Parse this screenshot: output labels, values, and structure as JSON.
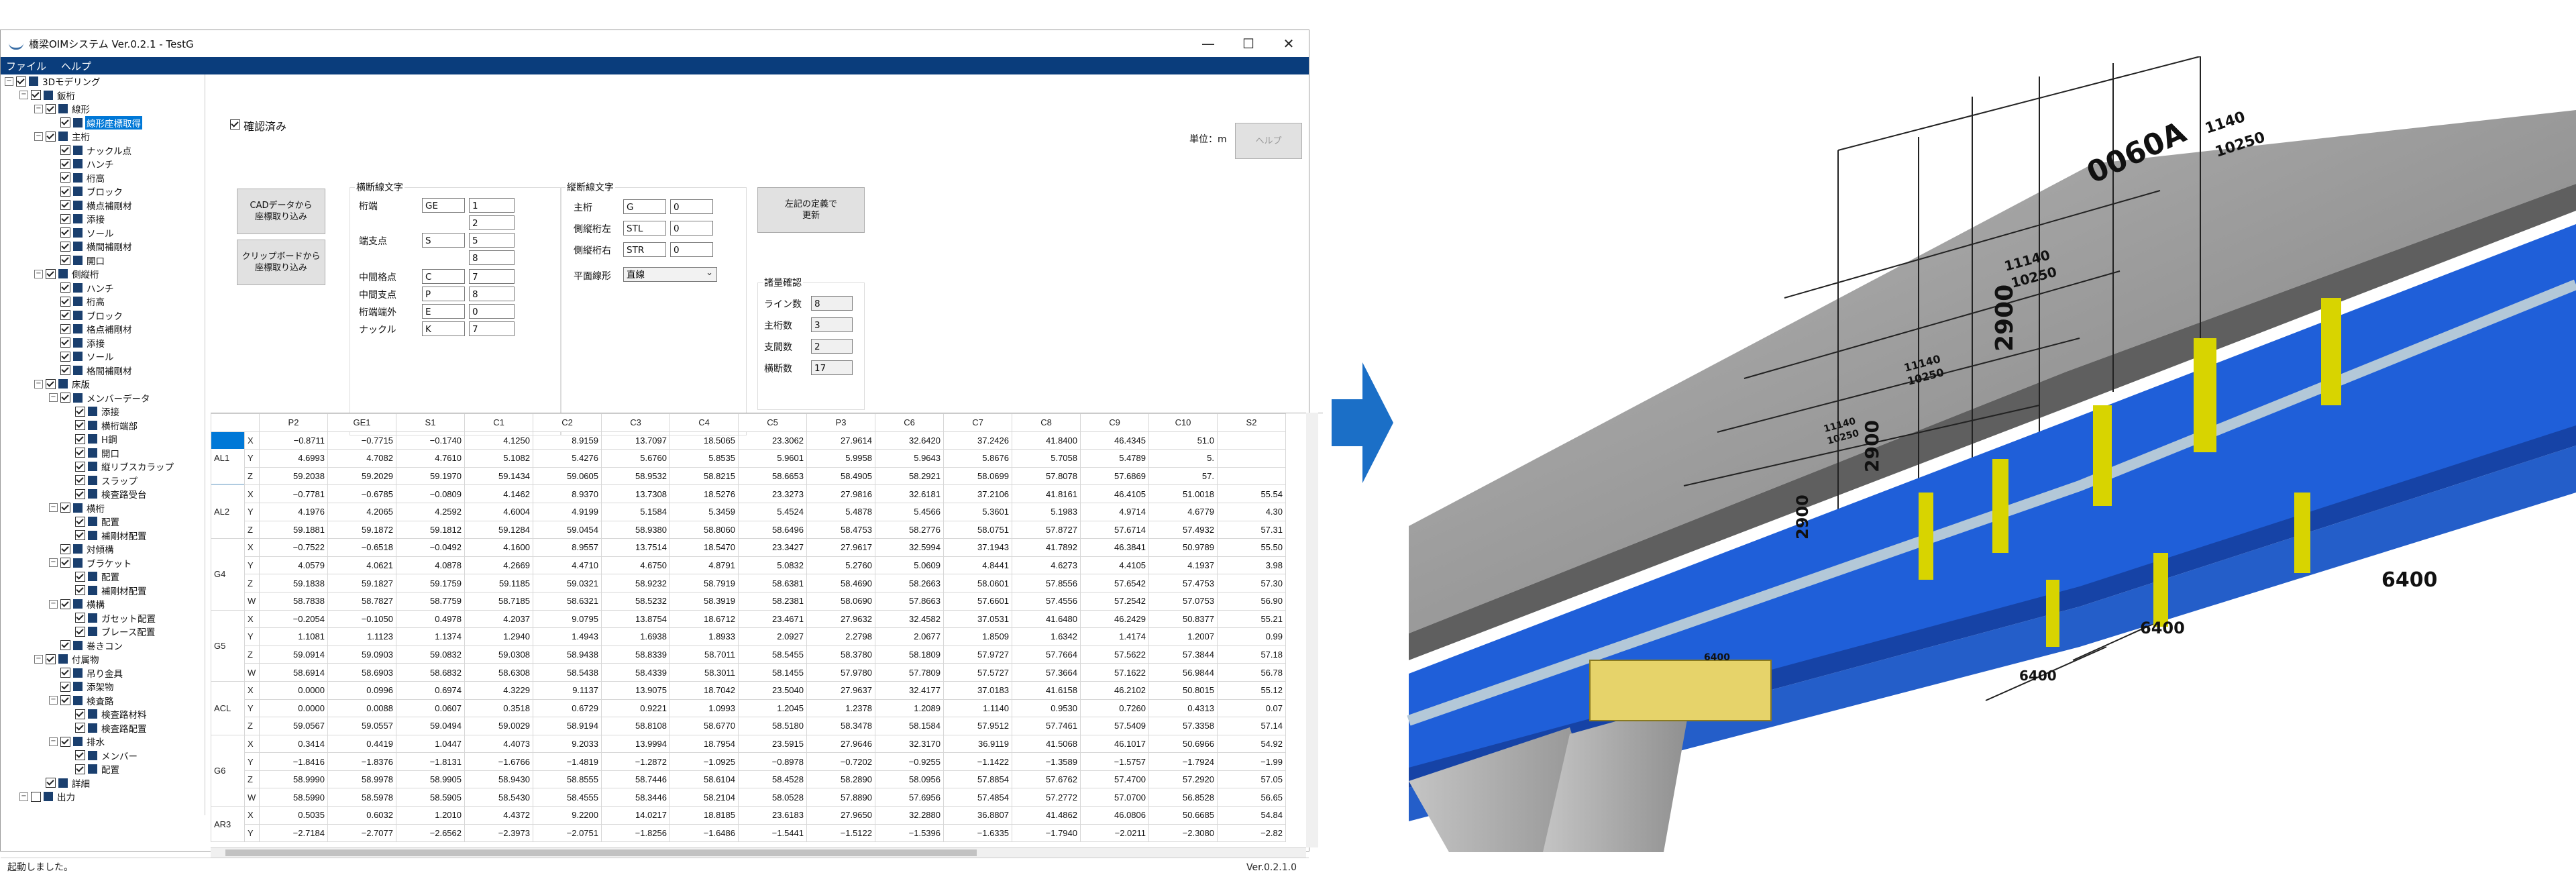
{
  "window": {
    "title": "橋梁OIMシステム Ver.0.2.1 - TestG",
    "min": "—",
    "max": "☐",
    "close": "✕"
  },
  "menu": [
    "ファイル",
    "ヘルプ"
  ],
  "tree": [
    {
      "d": 0,
      "label": "3Dモデリング",
      "exp": "−",
      "chk": true
    },
    {
      "d": 1,
      "label": "鈑桁",
      "exp": "−",
      "chk": true
    },
    {
      "d": 2,
      "label": "線形",
      "exp": "−",
      "chk": true
    },
    {
      "d": 3,
      "label": "線形座標取得",
      "sel": true,
      "chk": true
    },
    {
      "d": 2,
      "label": "主桁",
      "exp": "−",
      "chk": true
    },
    {
      "d": 3,
      "label": "ナックル点",
      "chk": true
    },
    {
      "d": 3,
      "label": "ハンチ",
      "chk": true
    },
    {
      "d": 3,
      "label": "桁高",
      "chk": true
    },
    {
      "d": 3,
      "label": "ブロック",
      "chk": true
    },
    {
      "d": 3,
      "label": "横点補剛材",
      "chk": true
    },
    {
      "d": 3,
      "label": "添接",
      "chk": true
    },
    {
      "d": 3,
      "label": "ソール",
      "chk": true
    },
    {
      "d": 3,
      "label": "横間補剛材",
      "chk": true
    },
    {
      "d": 3,
      "label": "開口",
      "chk": true
    },
    {
      "d": 2,
      "label": "側縦桁",
      "exp": "−",
      "chk": true
    },
    {
      "d": 3,
      "label": "ハンチ",
      "chk": true
    },
    {
      "d": 3,
      "label": "桁高",
      "chk": true
    },
    {
      "d": 3,
      "label": "ブロック",
      "chk": true
    },
    {
      "d": 3,
      "label": "格点補剛材",
      "chk": true
    },
    {
      "d": 3,
      "label": "添接",
      "chk": true
    },
    {
      "d": 3,
      "label": "ソール",
      "chk": true
    },
    {
      "d": 3,
      "label": "格間補剛材",
      "chk": true
    },
    {
      "d": 2,
      "label": "床版",
      "exp": "−",
      "chk": true
    },
    {
      "d": 3,
      "label": "メンバーデータ",
      "exp": "−",
      "chk": true
    },
    {
      "d": 4,
      "label": "添接",
      "chk": true
    },
    {
      "d": 4,
      "label": "横桁端部",
      "chk": true
    },
    {
      "d": 4,
      "label": "H鋼",
      "chk": true
    },
    {
      "d": 4,
      "label": "開口",
      "chk": true
    },
    {
      "d": 4,
      "label": "縦リブスカラップ",
      "chk": true
    },
    {
      "d": 4,
      "label": "スラップ",
      "chk": true
    },
    {
      "d": 4,
      "label": "検査路受台",
      "chk": true
    },
    {
      "d": 3,
      "label": "横桁",
      "exp": "−",
      "chk": true
    },
    {
      "d": 4,
      "label": "配置",
      "chk": true
    },
    {
      "d": 4,
      "label": "補剛材配置",
      "chk": true
    },
    {
      "d": 3,
      "label": "対傾構",
      "chk": true
    },
    {
      "d": 3,
      "label": "ブラケット",
      "exp": "−",
      "chk": true
    },
    {
      "d": 4,
      "label": "配置",
      "chk": true
    },
    {
      "d": 4,
      "label": "補剛材配置",
      "chk": true
    },
    {
      "d": 3,
      "label": "横構",
      "exp": "−",
      "chk": true
    },
    {
      "d": 4,
      "label": "ガセット配置",
      "chk": true
    },
    {
      "d": 4,
      "label": "ブレース配置",
      "chk": true
    },
    {
      "d": 3,
      "label": "巻きコン",
      "chk": true
    },
    {
      "d": 2,
      "label": "付属物",
      "exp": "−",
      "chk": true
    },
    {
      "d": 3,
      "label": "吊り金具",
      "chk": true
    },
    {
      "d": 3,
      "label": "添架物",
      "chk": true
    },
    {
      "d": 3,
      "label": "検査路",
      "exp": "−",
      "chk": true
    },
    {
      "d": 4,
      "label": "検査路材料",
      "chk": true
    },
    {
      "d": 4,
      "label": "検査路配置",
      "chk": true
    },
    {
      "d": 3,
      "label": "排水",
      "exp": "−",
      "chk": true
    },
    {
      "d": 4,
      "label": "メンバー",
      "chk": true
    },
    {
      "d": 4,
      "label": "配置",
      "chk": true
    },
    {
      "d": 2,
      "label": "詳細",
      "chk": true
    },
    {
      "d": 1,
      "label": "出力",
      "exp": "−",
      "chk": false
    }
  ],
  "panel": {
    "confirmed": "確認済み",
    "unit": "単位：m",
    "help_button": "ヘルプ",
    "cad_button": "CADデータから\n座標取り込み",
    "clip_button": "クリップボードから\n座標取り込み",
    "cross_group": "横断線文字",
    "cross": [
      {
        "label": "桁端",
        "text": "GE",
        "num": "1"
      },
      {
        "label": "",
        "text": null,
        "num": "2"
      },
      {
        "label": "端支点",
        "text": "S",
        "num": "5"
      },
      {
        "label": "",
        "text": null,
        "num": "8"
      },
      {
        "label": "中間格点",
        "text": "C",
        "num": "7"
      },
      {
        "label": "中間支点",
        "text": "P",
        "num": "8"
      },
      {
        "label": "桁端端外",
        "text": "E",
        "num": "0"
      },
      {
        "label": "ナックル",
        "text": "K",
        "num": "7"
      }
    ],
    "long_group": "縦断線文字",
    "long": [
      {
        "label": "主桁",
        "text": "G",
        "num": "0"
      },
      {
        "label": "側縦桁左",
        "text": "STL",
        "num": "0"
      },
      {
        "label": "側縦桁右",
        "text": "STR",
        "num": "0"
      }
    ],
    "plane_label": "平面線形",
    "plane_value": "直線",
    "update_button": "左記の定義で\n更新",
    "count_group": "諸量確認",
    "counts": [
      {
        "label": "ライン数",
        "value": "8"
      },
      {
        "label": "主桁数",
        "value": "3"
      },
      {
        "label": "支間数",
        "value": "2"
      },
      {
        "label": "横断数",
        "value": "17"
      }
    ]
  },
  "grid": {
    "columns": [
      "P2",
      "GE1",
      "S1",
      "C1",
      "C2",
      "C3",
      "C4",
      "C5",
      "P3",
      "C6",
      "C7",
      "C8",
      "C9",
      "C10",
      "S2"
    ],
    "groups": [
      {
        "name": "AL1",
        "rows": [
          {
            "axis": "X",
            "v": [
              "−0.8711",
              "−0.7715",
              "−0.1740",
              "4.1250",
              "8.9159",
              "13.7097",
              "18.5065",
              "23.3062",
              "27.9614",
              "32.6420",
              "37.2426",
              "41.8400",
              "46.4345",
              "51.0",
              ""
            ],
            "selfirst": true
          },
          {
            "axis": "Y",
            "v": [
              "4.6993",
              "4.7082",
              "4.7610",
              "5.1082",
              "5.4276",
              "5.6760",
              "5.8535",
              "5.9601",
              "5.9958",
              "5.9643",
              "5.8676",
              "5.7058",
              "5.4789",
              "5.",
              ""
            ]
          },
          {
            "axis": "Z",
            "v": [
              "59.2038",
              "59.2029",
              "59.1970",
              "59.1434",
              "59.0605",
              "58.9532",
              "58.8215",
              "58.6653",
              "58.4905",
              "58.2921",
              "58.0699",
              "57.8078",
              "57.6869",
              "57.",
              ""
            ]
          }
        ]
      },
      {
        "name": "AL2",
        "rows": [
          {
            "axis": "X",
            "v": [
              "−0.7781",
              "−0.6785",
              "−0.0809",
              "4.1462",
              "8.9370",
              "13.7308",
              "18.5276",
              "23.3273",
              "27.9816",
              "32.6181",
              "37.2106",
              "41.8161",
              "46.4105",
              "51.0018",
              "55.54"
            ]
          },
          {
            "axis": "Y",
            "v": [
              "4.1976",
              "4.2065",
              "4.2592",
              "4.6004",
              "4.9199",
              "5.1584",
              "5.3459",
              "5.4524",
              "5.4878",
              "5.4566",
              "5.3601",
              "5.1983",
              "4.9714",
              "4.6779",
              "4.30"
            ]
          },
          {
            "axis": "Z",
            "v": [
              "59.1881",
              "59.1872",
              "59.1812",
              "59.1284",
              "59.0454",
              "58.9380",
              "58.8060",
              "58.6496",
              "58.4753",
              "58.2776",
              "58.0751",
              "57.8727",
              "57.6714",
              "57.4932",
              "57.31"
            ]
          }
        ]
      },
      {
        "name": "G4",
        "rows": [
          {
            "axis": "X",
            "v": [
              "−0.7522",
              "−0.6518",
              "−0.0492",
              "4.1600",
              "8.9557",
              "13.7514",
              "18.5470",
              "23.3427",
              "27.9617",
              "32.5994",
              "37.1943",
              "41.7892",
              "46.3841",
              "50.9789",
              "55.50"
            ]
          },
          {
            "axis": "Y",
            "v": [
              "4.0579",
              "4.0621",
              "4.0878",
              "4.2669",
              "4.4710",
              "4.6750",
              "4.8791",
              "5.0832",
              "5.2760",
              "5.0609",
              "4.8441",
              "4.6273",
              "4.4105",
              "4.1937",
              "3.98"
            ]
          },
          {
            "axis": "Z",
            "v": [
              "59.1838",
              "59.1827",
              "59.1759",
              "59.1185",
              "59.0321",
              "58.9232",
              "58.7919",
              "58.6381",
              "58.4690",
              "58.2663",
              "58.0601",
              "57.8556",
              "57.6542",
              "57.4753",
              "57.30"
            ]
          },
          {
            "axis": "W",
            "v": [
              "58.7838",
              "58.7827",
              "58.7759",
              "58.7185",
              "58.6321",
              "58.5232",
              "58.3919",
              "58.2381",
              "58.0690",
              "57.8663",
              "57.6601",
              "57.4556",
              "57.2542",
              "57.0753",
              "56.90"
            ]
          }
        ]
      },
      {
        "name": "G5",
        "rows": [
          {
            "axis": "X",
            "v": [
              "−0.2054",
              "−0.1050",
              "0.4978",
              "4.2037",
              "9.0795",
              "13.8754",
              "18.6712",
              "23.4671",
              "27.9632",
              "32.4582",
              "37.0531",
              "41.6480",
              "46.2429",
              "50.8377",
              "55.21"
            ]
          },
          {
            "axis": "Y",
            "v": [
              "1.1081",
              "1.1123",
              "1.1374",
              "1.2940",
              "1.4943",
              "1.6938",
              "1.8933",
              "2.0927",
              "2.2798",
              "2.0677",
              "1.8509",
              "1.6342",
              "1.4174",
              "1.2007",
              "0.99"
            ]
          },
          {
            "axis": "Z",
            "v": [
              "59.0914",
              "59.0903",
              "59.0832",
              "59.0308",
              "58.9438",
              "58.8339",
              "58.7011",
              "58.5455",
              "58.3780",
              "58.1809",
              "57.9727",
              "57.7664",
              "57.5622",
              "57.3844",
              "57.18"
            ]
          },
          {
            "axis": "W",
            "v": [
              "58.6914",
              "58.6903",
              "58.6832",
              "58.6308",
              "58.5438",
              "58.4339",
              "58.3011",
              "58.1455",
              "57.9780",
              "57.7809",
              "57.5727",
              "57.3664",
              "57.1622",
              "56.9844",
              "56.78"
            ]
          }
        ]
      },
      {
        "name": "ACL",
        "rows": [
          {
            "axis": "X",
            "v": [
              "0.0000",
              "0.0996",
              "0.6974",
              "4.3229",
              "9.1137",
              "13.9075",
              "18.7042",
              "23.5040",
              "27.9637",
              "32.4177",
              "37.0183",
              "41.6158",
              "46.2102",
              "50.8015",
              "55.12"
            ]
          },
          {
            "axis": "Y",
            "v": [
              "0.0000",
              "0.0088",
              "0.0607",
              "0.3518",
              "0.6729",
              "0.9221",
              "1.0993",
              "1.2045",
              "1.2378",
              "1.2089",
              "1.1140",
              "0.9530",
              "0.7260",
              "0.4313",
              "0.07"
            ]
          },
          {
            "axis": "Z",
            "v": [
              "59.0567",
              "59.0557",
              "59.0494",
              "59.0029",
              "58.9194",
              "58.8108",
              "58.6770",
              "58.5180",
              "58.3478",
              "58.1584",
              "57.9512",
              "57.7461",
              "57.5409",
              "57.3358",
              "57.14"
            ]
          }
        ]
      },
      {
        "name": "G6",
        "rows": [
          {
            "axis": "X",
            "v": [
              "0.3414",
              "0.4419",
              "1.0447",
              "4.4073",
              "9.2033",
              "13.9994",
              "18.7954",
              "23.5915",
              "27.9646",
              "32.3170",
              "36.9119",
              "41.5068",
              "46.1017",
              "50.6966",
              "54.92"
            ]
          },
          {
            "axis": "Y",
            "v": [
              "−1.8416",
              "−1.8376",
              "−1.8131",
              "−1.6766",
              "−1.4819",
              "−1.2872",
              "−1.0925",
              "−0.8978",
              "−0.7202",
              "−0.9255",
              "−1.1422",
              "−1.3589",
              "−1.5757",
              "−1.7924",
              "−1.99"
            ]
          },
          {
            "axis": "Z",
            "v": [
              "58.9990",
              "58.9978",
              "58.9905",
              "58.9430",
              "58.8555",
              "58.7446",
              "58.6104",
              "58.4528",
              "58.2890",
              "58.0956",
              "57.8854",
              "57.6762",
              "57.4700",
              "57.2920",
              "57.05"
            ]
          },
          {
            "axis": "W",
            "v": [
              "58.5990",
              "58.5978",
              "58.5905",
              "58.5430",
              "58.4555",
              "58.3446",
              "58.2104",
              "58.0528",
              "57.8890",
              "57.6956",
              "57.4854",
              "57.2772",
              "57.0700",
              "56.8528",
              "56.65"
            ]
          }
        ]
      },
      {
        "name": "AR3",
        "rows": [
          {
            "axis": "X",
            "v": [
              "0.5035",
              "0.6032",
              "1.2010",
              "4.4372",
              "9.2200",
              "14.0217",
              "18.8185",
              "23.6183",
              "27.9650",
              "32.2880",
              "36.8807",
              "41.4862",
              "46.0806",
              "50.6685",
              "54.84"
            ]
          },
          {
            "axis": "Y",
            "v": [
              "−2.7184",
              "−2.7077",
              "−2.6562",
              "−2.3973",
              "−2.0751",
              "−1.8256",
              "−1.6486",
              "−1.5441",
              "−1.5122",
              "−1.5396",
              "−1.6335",
              "−1.7940",
              "−2.0211",
              "−2.3080",
              "−2.82"
            ]
          }
        ]
      }
    ]
  },
  "status": {
    "left": "起動しました。",
    "right": "Ver.0.2.1.0"
  },
  "render_labels": {
    "dims": [
      "1140",
      "10250",
      "11140",
      "10250",
      "11140",
      "10250",
      "11140",
      "10250",
      "6400",
      "6400",
      "6400",
      "6400"
    ],
    "heights": [
      "2900",
      "2900",
      "2900"
    ],
    "station": "0060A"
  },
  "colors": {
    "menubar": "#0a3d7c",
    "selection": "#0078d7",
    "girder_blue": "#1f5fd9",
    "slab_gray": "#8a8a8a",
    "arrow": "#1b6fc7",
    "stiffener": "#d8d400"
  }
}
